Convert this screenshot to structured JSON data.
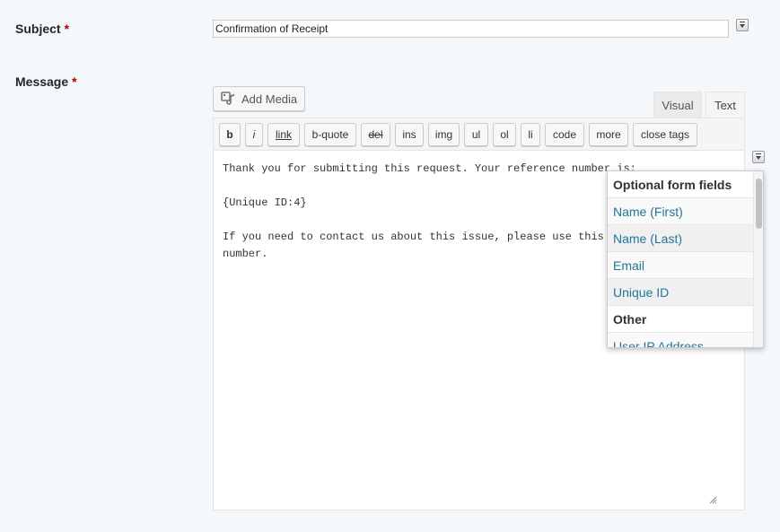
{
  "subject": {
    "label": "Subject",
    "required_mark": "*",
    "value": "Confirmation of Receipt",
    "merge_tag_icon": "merge-tag-icon"
  },
  "message": {
    "label": "Message",
    "required_mark": "*",
    "add_media_label": "Add Media",
    "add_media_icon": "add-media-icon",
    "tabs": [
      {
        "label": "Visual",
        "active": false
      },
      {
        "label": "Text",
        "active": true
      }
    ],
    "quicktags": [
      "b",
      "i",
      "link",
      "b-quote",
      "del",
      "ins",
      "img",
      "ul",
      "ol",
      "li",
      "code",
      "more",
      "close tags"
    ],
    "content_lines": [
      "Thank you for submitting this request. Your reference number is:",
      "",
      "{Unique ID:4}",
      "",
      "If you need to contact us about this issue, please use this",
      "number."
    ],
    "merge_tag_icon": "merge-tag-icon"
  },
  "merge_dropdown": {
    "rows": [
      {
        "text": "Optional form fields",
        "kind": "header"
      },
      {
        "text": "Name (First)",
        "kind": "item"
      },
      {
        "text": "Name (Last)",
        "kind": "item"
      },
      {
        "text": "Email",
        "kind": "item"
      },
      {
        "text": "Unique ID",
        "kind": "item"
      },
      {
        "text": "Other",
        "kind": "header"
      },
      {
        "text": "User IP Address",
        "kind": "item"
      }
    ]
  },
  "colors": {
    "page_bg": "#f5f8fb",
    "required": "#aa0000",
    "link": "#21759b"
  }
}
